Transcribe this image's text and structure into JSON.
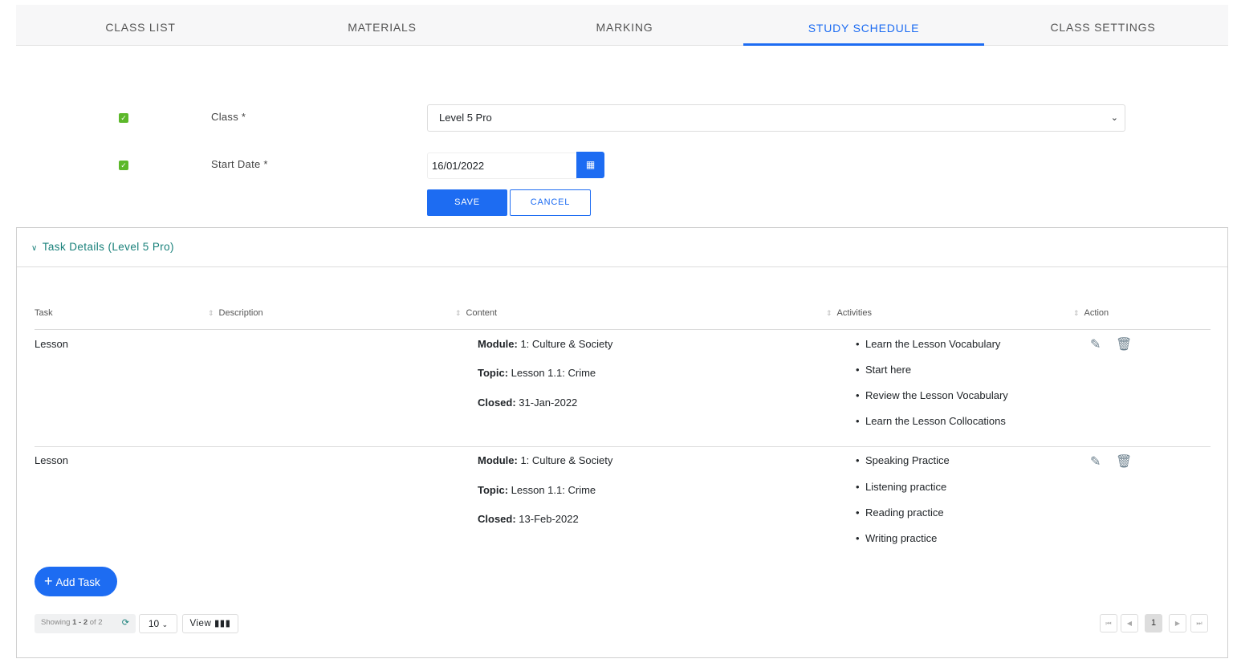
{
  "tabs": [
    {
      "label": "CLASS LIST"
    },
    {
      "label": "MATERIALS"
    },
    {
      "label": "MARKING"
    },
    {
      "label": "STUDY SCHEDULE",
      "active": true
    },
    {
      "label": "CLASS SETTINGS"
    }
  ],
  "form": {
    "class_label": "Class *",
    "class_value": "Level 5 Pro",
    "start_label": "Start Date *",
    "start_value": "16/01/2022",
    "save": "SAVE",
    "cancel": "CANCEL"
  },
  "panel": {
    "title": "Task Details (Level 5 Pro)",
    "columns": [
      "Task",
      "Description",
      "Content",
      "Activities",
      "Action"
    ],
    "rows": [
      {
        "task": "Lesson",
        "module_label": "Module:",
        "module": " 1: Culture & Society",
        "topic_label": "Topic:",
        "topic": " Lesson 1.1: Crime",
        "closed_label": "Closed:",
        "closed": " 31-Jan-2022",
        "activities": [
          "Learn the Lesson Vocabulary",
          "Start here",
          "Review the Lesson Vocabulary",
          "Learn the Lesson Collocations"
        ]
      },
      {
        "task": "Lesson",
        "module_label": "Module:",
        "module": " 1: Culture & Society",
        "topic_label": "Topic:",
        "topic": " Lesson 1.1: Crime",
        "closed_label": "Closed:",
        "closed": " 13-Feb-2022",
        "activities": [
          "Speaking Practice",
          "Listening practice",
          "Reading practice",
          "Writing practice"
        ]
      }
    ],
    "add_task": "Add Task",
    "showing_prefix": "Showing ",
    "showing_range": "1 - 2",
    "showing_suffix": " of 2",
    "page_size": "10",
    "view": "View",
    "current_page": "1"
  },
  "colors": {
    "accent": "#1d6cf2",
    "check": "#5cb82a",
    "panel_title": "#18807a"
  }
}
